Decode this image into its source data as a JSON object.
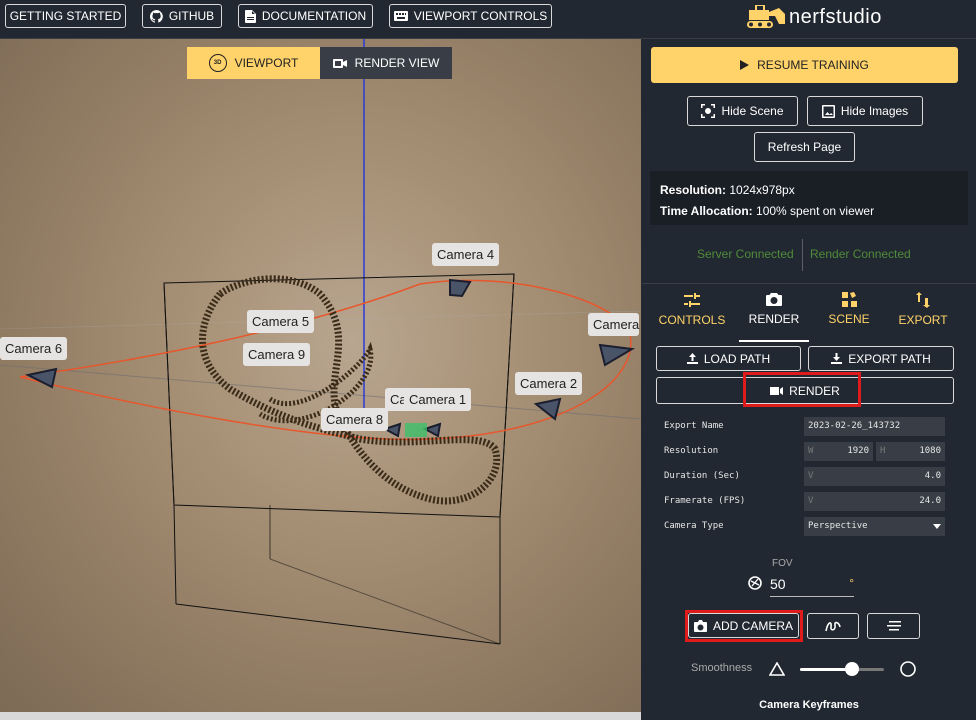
{
  "topbar": {
    "getting_started": "GETTING STARTED",
    "github": "GITHUB",
    "documentation": "DOCUMENTATION",
    "viewport_controls": "VIEWPORT CONTROLS",
    "logo_text": "nerfstudio"
  },
  "viewport": {
    "toggle_viewport": "VIEWPORT",
    "toggle_render_view": "RENDER VIEW",
    "badge_3d": "3D",
    "cameras": [
      "Camera 4",
      "Camera 5",
      "Camera 9",
      "Camera 6",
      "Camera 2",
      "Camera 1",
      "Camera 8",
      "Ca",
      "Camera"
    ]
  },
  "panel": {
    "resume_training": "RESUME TRAINING",
    "hide_scene": "Hide Scene",
    "hide_images": "Hide Images",
    "refresh_page": "Refresh Page",
    "resolution_label": "Resolution:",
    "resolution_value": "1024x978px",
    "time_label": "Time Allocation:",
    "time_value": "100% spent on viewer",
    "server_status": "Server Connected",
    "render_status": "Render Connected",
    "tabs": [
      {
        "label": "CONTROLS",
        "icon": "sliders-icon"
      },
      {
        "label": "RENDER",
        "icon": "camera-icon"
      },
      {
        "label": "SCENE",
        "icon": "grid-icon"
      },
      {
        "label": "EXPORT",
        "icon": "export-icon"
      }
    ],
    "load_path": "LOAD PATH",
    "export_path": "EXPORT PATH",
    "render": "RENDER",
    "form": {
      "export_name_label": "Export Name",
      "export_name_value": "2023-02-26_143732",
      "resolution_label": "Resolution",
      "res_w_prefix": "W",
      "res_w": "1920",
      "res_h_prefix": "H",
      "res_h": "1080",
      "duration_label": "Duration (Sec)",
      "duration_prefix": "V",
      "duration_value": "4.0",
      "framerate_label": "Framerate (FPS)",
      "framerate_prefix": "V",
      "framerate_value": "24.0",
      "camera_type_label": "Camera Type",
      "camera_type_value": "Perspective"
    },
    "fov_label": "FOV",
    "fov_value": "50",
    "fov_unit": "°",
    "add_camera": "ADD CAMERA",
    "smoothness_label": "Smoothness",
    "smoothness_level": 0.62,
    "camera_keyframes": "Camera Keyframes"
  },
  "colors": {
    "accent": "#ffd369",
    "background": "#222831",
    "highlight": "#e01b1b",
    "connected": "#4f8b3a"
  }
}
